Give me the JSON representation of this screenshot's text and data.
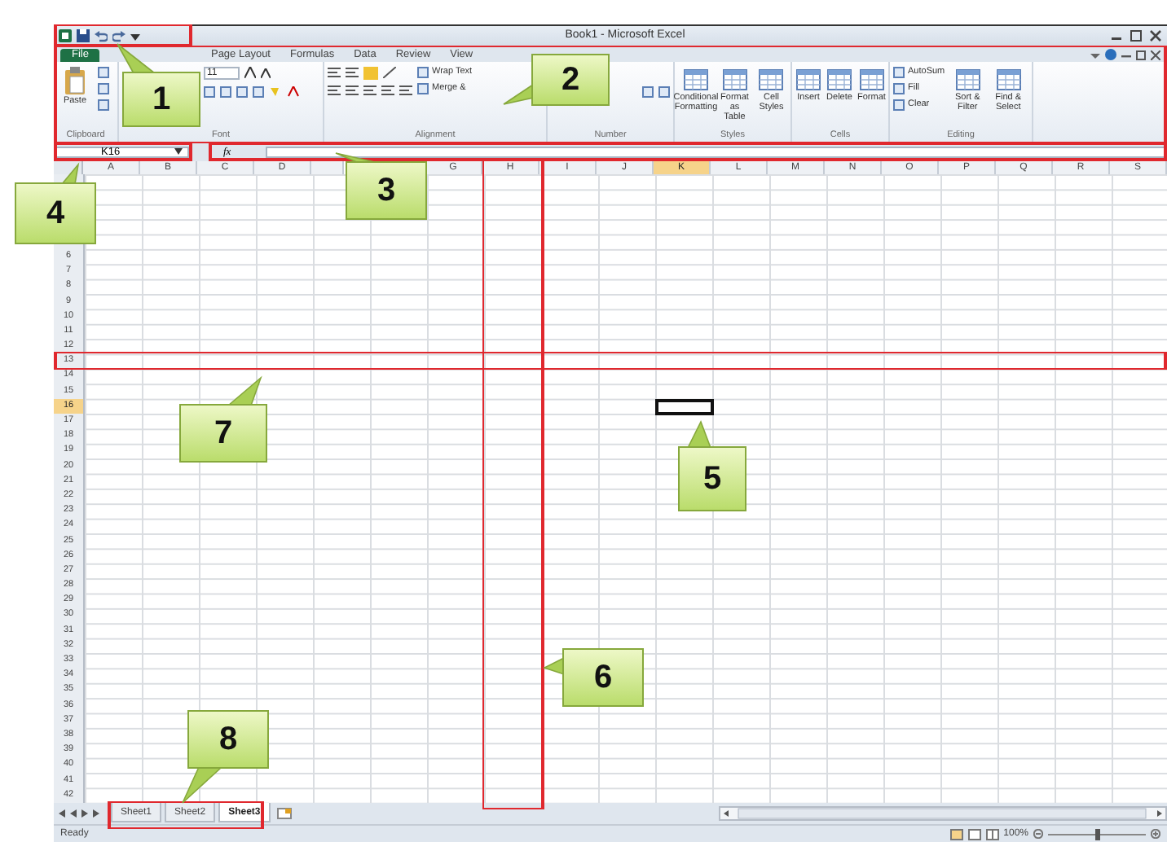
{
  "window": {
    "title": "Book1 - Microsoft Excel"
  },
  "ribbon_tabs": [
    {
      "label": "File",
      "kind": "file",
      "selected": false
    },
    {
      "label": "Page Layout",
      "kind": "tab",
      "selected": false
    },
    {
      "label": "Formulas",
      "kind": "tab",
      "selected": false
    },
    {
      "label": "Data",
      "kind": "tab",
      "selected": false
    },
    {
      "label": "Review",
      "kind": "tab",
      "selected": false
    },
    {
      "label": "View",
      "kind": "tab",
      "selected": false
    }
  ],
  "ribbon": {
    "groups": [
      {
        "label": "Clipboard",
        "kind": "clipboard",
        "items": [
          {
            "kind": "large",
            "label": "Paste"
          }
        ]
      },
      {
        "label": "Font",
        "kind": "font",
        "items": [
          {
            "kind": "field",
            "value": "11"
          }
        ]
      },
      {
        "label": "Alignment",
        "kind": "alignment",
        "items": [
          {
            "kind": "small",
            "label": "Wrap Text"
          },
          {
            "kind": "small",
            "label": "Merge &"
          }
        ]
      },
      {
        "label": "Number",
        "kind": "number"
      },
      {
        "label": "Styles",
        "kind": "plain",
        "items": [
          {
            "kind": "large",
            "label": "Conditional Formatting"
          },
          {
            "kind": "large",
            "label": "Format as Table"
          },
          {
            "kind": "large",
            "label": "Cell Styles"
          }
        ]
      },
      {
        "label": "Cells",
        "kind": "plain",
        "items": [
          {
            "kind": "large",
            "label": "Insert"
          },
          {
            "kind": "large",
            "label": "Delete"
          },
          {
            "kind": "large",
            "label": "Format"
          }
        ]
      },
      {
        "label": "Editing",
        "kind": "plain",
        "items": [
          {
            "kind": "small",
            "label": "AutoSum"
          },
          {
            "kind": "small",
            "label": "Fill"
          },
          {
            "kind": "small",
            "label": "Clear"
          },
          {
            "kind": "large",
            "label": "Sort & Filter"
          },
          {
            "kind": "large",
            "label": "Find & Select"
          }
        ]
      }
    ]
  },
  "name_box": {
    "value": "K16"
  },
  "formula_bar": {
    "function_label": "fx"
  },
  "grid": {
    "columns_before_gap": [
      {
        "label": "A",
        "selected": false
      },
      {
        "label": "B",
        "selected": false
      },
      {
        "label": "C",
        "selected": false
      },
      {
        "label": "D",
        "selected": false
      }
    ],
    "columns_after_gap": [
      {
        "label": "G",
        "selected": false
      },
      {
        "label": "H",
        "selected": false
      },
      {
        "label": "I",
        "selected": false
      },
      {
        "label": "J",
        "selected": false
      },
      {
        "label": "K",
        "selected": true
      },
      {
        "label": "L",
        "selected": false
      },
      {
        "label": "M",
        "selected": false
      },
      {
        "label": "N",
        "selected": false
      },
      {
        "label": "O",
        "selected": false
      },
      {
        "label": "P",
        "selected": false
      },
      {
        "label": "Q",
        "selected": false
      },
      {
        "label": "R",
        "selected": false
      },
      {
        "label": "S",
        "selected": false
      }
    ],
    "row_headers": [
      {
        "label": "6",
        "selected": false
      },
      {
        "label": "7",
        "selected": false
      },
      {
        "label": "8",
        "selected": false
      },
      {
        "label": "9",
        "selected": false
      },
      {
        "label": "10",
        "selected": false
      },
      {
        "label": "11",
        "selected": false
      },
      {
        "label": "12",
        "selected": false
      },
      {
        "label": "13",
        "selected": false
      },
      {
        "label": "14",
        "selected": false
      },
      {
        "label": "15",
        "selected": false
      },
      {
        "label": "16",
        "selected": true
      },
      {
        "label": "17",
        "selected": false
      },
      {
        "label": "18",
        "selected": false
      },
      {
        "label": "19",
        "selected": false
      },
      {
        "label": "20",
        "selected": false
      },
      {
        "label": "21",
        "selected": false
      },
      {
        "label": "22",
        "selected": false
      },
      {
        "label": "23",
        "selected": false
      },
      {
        "label": "24",
        "selected": false
      },
      {
        "label": "25",
        "selected": false
      },
      {
        "label": "26",
        "selected": false
      },
      {
        "label": "27",
        "selected": false
      },
      {
        "label": "28",
        "selected": false
      },
      {
        "label": "29",
        "selected": false
      },
      {
        "label": "30",
        "selected": false
      },
      {
        "label": "31",
        "selected": false
      },
      {
        "label": "32",
        "selected": false
      },
      {
        "label": "33",
        "selected": false
      },
      {
        "label": "34",
        "selected": false
      },
      {
        "label": "35",
        "selected": false
      },
      {
        "label": "36",
        "selected": false
      },
      {
        "label": "37",
        "selected": false
      },
      {
        "label": "38",
        "selected": false
      },
      {
        "label": "39",
        "selected": false
      },
      {
        "label": "40",
        "selected": false
      },
      {
        "label": "41",
        "selected": false
      },
      {
        "label": "42",
        "selected": false
      }
    ]
  },
  "sheet_tabs": [
    {
      "label": "Sheet1",
      "selected": false
    },
    {
      "label": "Sheet2",
      "selected": false
    },
    {
      "label": "Sheet3",
      "selected": true
    }
  ],
  "status_bar": {
    "text": "Ready",
    "zoom": "100%",
    "zoom_slider": {
      "level": 0.5
    }
  },
  "callouts": [
    {
      "label": "1"
    },
    {
      "label": "2"
    },
    {
      "label": "3"
    },
    {
      "label": "4"
    },
    {
      "label": "5"
    },
    {
      "label": "6"
    },
    {
      "label": "7"
    },
    {
      "label": "8"
    }
  ]
}
